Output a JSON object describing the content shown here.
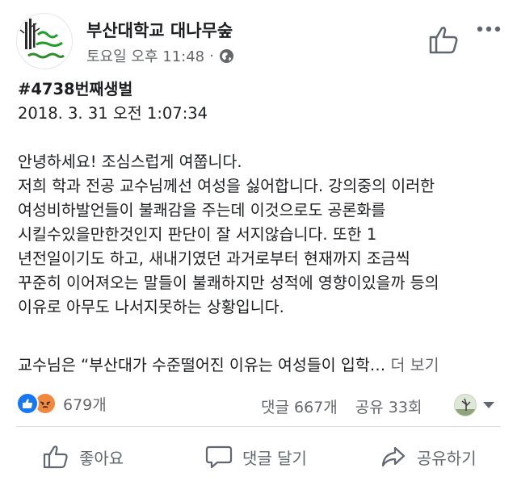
{
  "post": {
    "page_name": "부산대학교 대나무숲",
    "timestamp": "토요일 오후 11:48",
    "meta_dot": "·",
    "title": "#4738번째생벌",
    "date": "2018. 3. 31 오전 1:07:34",
    "body_lines": [
      "안녕하세요! 조심스럽게 여쭙니다.",
      "저희 학과 전공 교수님께선 여성을 싫어합니다. 강의중의 이러한",
      "여성비하발언들이 불쾌감을 주는데 이것으로도 공론화를",
      "시킬수있을만한것인지 판단이 잘 서지않습니다. 또한 1",
      "년전일이기도 하고, 새내기였던 과거로부터 현재까지 조금씩",
      "꾸준히 이어져오는 말들이 불쾌하지만 성적에 영향이있을까 등의",
      "이유로 아무도 나서지못하는 상황입니다."
    ],
    "truncated_line": "교수님은 “부산대가 수준떨어진 이유는 여성들이 입학…",
    "see_more": "더 보기"
  },
  "stats": {
    "reaction_count": "679개",
    "comments": "댓글 667개",
    "shares": "공유 33회"
  },
  "actions": {
    "like": "좋아요",
    "comment": "댓글 달기",
    "share": "공유하기"
  },
  "colors": {
    "like_blue": "#1877f2",
    "angry_orange": "#f0883e",
    "avatar_green": "#2e8b2e",
    "secondary_text": "#65676b"
  },
  "icons": {
    "reactions": [
      "like-reaction-icon",
      "angry-reaction-icon"
    ],
    "actions": [
      "thumbs-up-icon",
      "comment-bubble-icon",
      "share-arrow-icon"
    ]
  }
}
